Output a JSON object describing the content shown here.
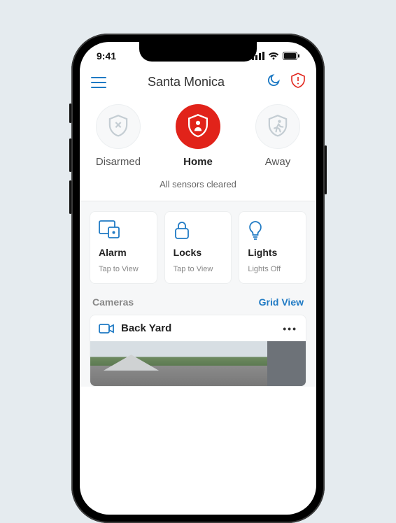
{
  "status": {
    "time": "9:41"
  },
  "nav": {
    "title": "Santa Monica"
  },
  "modes": {
    "items": [
      {
        "label": "Disarmed"
      },
      {
        "label": "Home"
      },
      {
        "label": "Away"
      }
    ],
    "status": "All sensors cleared"
  },
  "tiles": [
    {
      "title": "Alarm",
      "subtitle": "Tap to View"
    },
    {
      "title": "Locks",
      "subtitle": "Tap to View"
    },
    {
      "title": "Lights",
      "subtitle": "Lights Off"
    }
  ],
  "cameras": {
    "section_label": "Cameras",
    "grid_view_label": "Grid View",
    "items": [
      {
        "name": "Back Yard"
      }
    ]
  }
}
